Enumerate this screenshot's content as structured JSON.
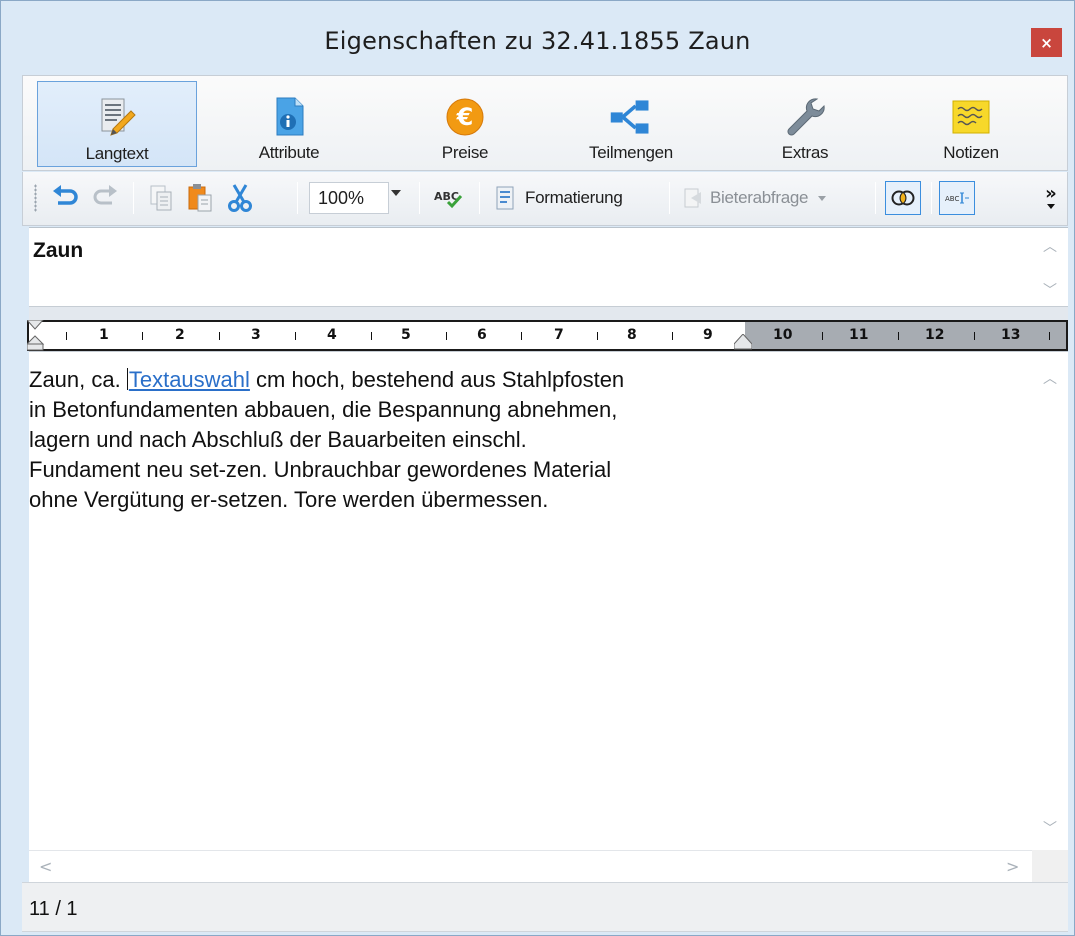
{
  "window": {
    "title": "Eigenschaften zu 32.41.1855 Zaun",
    "close_label": "×"
  },
  "ribbon": {
    "tabs": [
      {
        "label": "Langtext",
        "icon": "document-pencil-icon",
        "active": true
      },
      {
        "label": "Attribute",
        "icon": "document-info-icon",
        "active": false
      },
      {
        "label": "Preise",
        "icon": "euro-coin-icon",
        "active": false
      },
      {
        "label": "Teilmengen",
        "icon": "split-arrows-icon",
        "active": false
      },
      {
        "label": "Extras",
        "icon": "wrench-icon",
        "active": false
      },
      {
        "label": "Notizen",
        "icon": "sticky-note-icon",
        "active": false
      }
    ]
  },
  "toolbar": {
    "zoom": "100%",
    "spellcheck_label": "ABC",
    "format_label": "Formatierung",
    "bidder_label": "Bieterabfrage",
    "overflow_label": "»"
  },
  "headline": {
    "text": "Zaun"
  },
  "ruler": {
    "numbers": [
      "1",
      "2",
      "3",
      "4",
      "5",
      "6",
      "7",
      "8",
      "9",
      "10",
      "11",
      "12",
      "13"
    ]
  },
  "editor": {
    "line1_before": "Zaun, ca. ",
    "line1_link": "Textauswahl",
    "line1_after": " cm hoch, bestehend aus Stahlpfosten",
    "line2": "in Betonfundamenten abbauen, die Bespannung abnehmen,",
    "line3": "lagern und nach Abschluß der Bauarbeiten einschl.",
    "line4": "Fundament neu set-zen. Unbrauchbar gewordenes Material",
    "line5": "ohne Vergütung er-setzen. Tore werden übermessen."
  },
  "status": {
    "position": "11 / 1"
  },
  "colors": {
    "accent": "#3b8ede",
    "close": "#c9463d",
    "link": "#2a6fc9"
  }
}
